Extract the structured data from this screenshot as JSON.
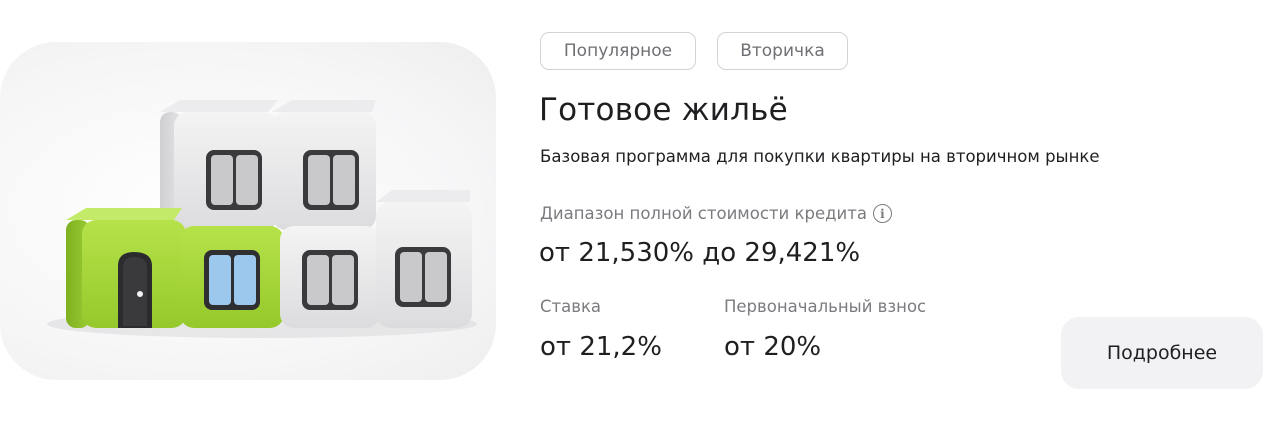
{
  "tags": [
    "Популярное",
    "Вторичка"
  ],
  "title": "Готовое жильё",
  "subtitle": "Базовая программа для покупки квартиры на вторичном рынке",
  "range": {
    "label": "Диапазон полной стоимости кредита",
    "value": "от 21,530% до 29,421%"
  },
  "stats": {
    "rate_label": "Ставка",
    "rate_value": "от 21,2%",
    "down_payment_label": "Первоначальный взнос",
    "down_payment_value": "от 20%"
  },
  "button_label": "Подробнее",
  "icons": {
    "info": "info-icon",
    "illustration": "house-blocks-illustration"
  },
  "colors": {
    "accent_green": "#a6d83a",
    "window_blue": "#9cc8ee",
    "text_primary": "#1f1f22",
    "text_secondary": "#7b7b80",
    "button_bg": "#f2f2f4"
  }
}
